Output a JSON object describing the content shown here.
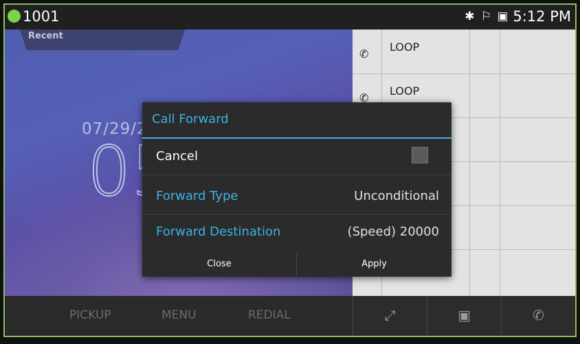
{
  "statusbar": {
    "line_number": "1001",
    "line_status_color": "#7fd14a",
    "icons": [
      "bluetooth-icon",
      "headset-icon",
      "screen-icon"
    ],
    "time": "5:12 PM"
  },
  "recent": {
    "tab_label": "Recent",
    "date": "07/29/2",
    "clock": "05"
  },
  "speed_dials": [
    {
      "label": "LOOP"
    },
    {
      "label": "LOOP"
    }
  ],
  "softkeys": {
    "pickup": "PICKUP",
    "menu": "MENU",
    "redial": "REDIAL"
  },
  "bottom_icons": [
    "expand-icon",
    "transfer-screen-icon",
    "call-forward-icon"
  ],
  "dialog": {
    "title": "Call Forward",
    "cancel_label": "Cancel",
    "forward_type_label": "Forward Type",
    "forward_type_value": "Unconditional",
    "forward_destination_label": "Forward Destination",
    "forward_destination_value": "(Speed) 20000",
    "close_label": "Close",
    "apply_label": "Apply"
  },
  "colors": {
    "accent": "#3ab3e6",
    "frame": "#8fc060"
  }
}
